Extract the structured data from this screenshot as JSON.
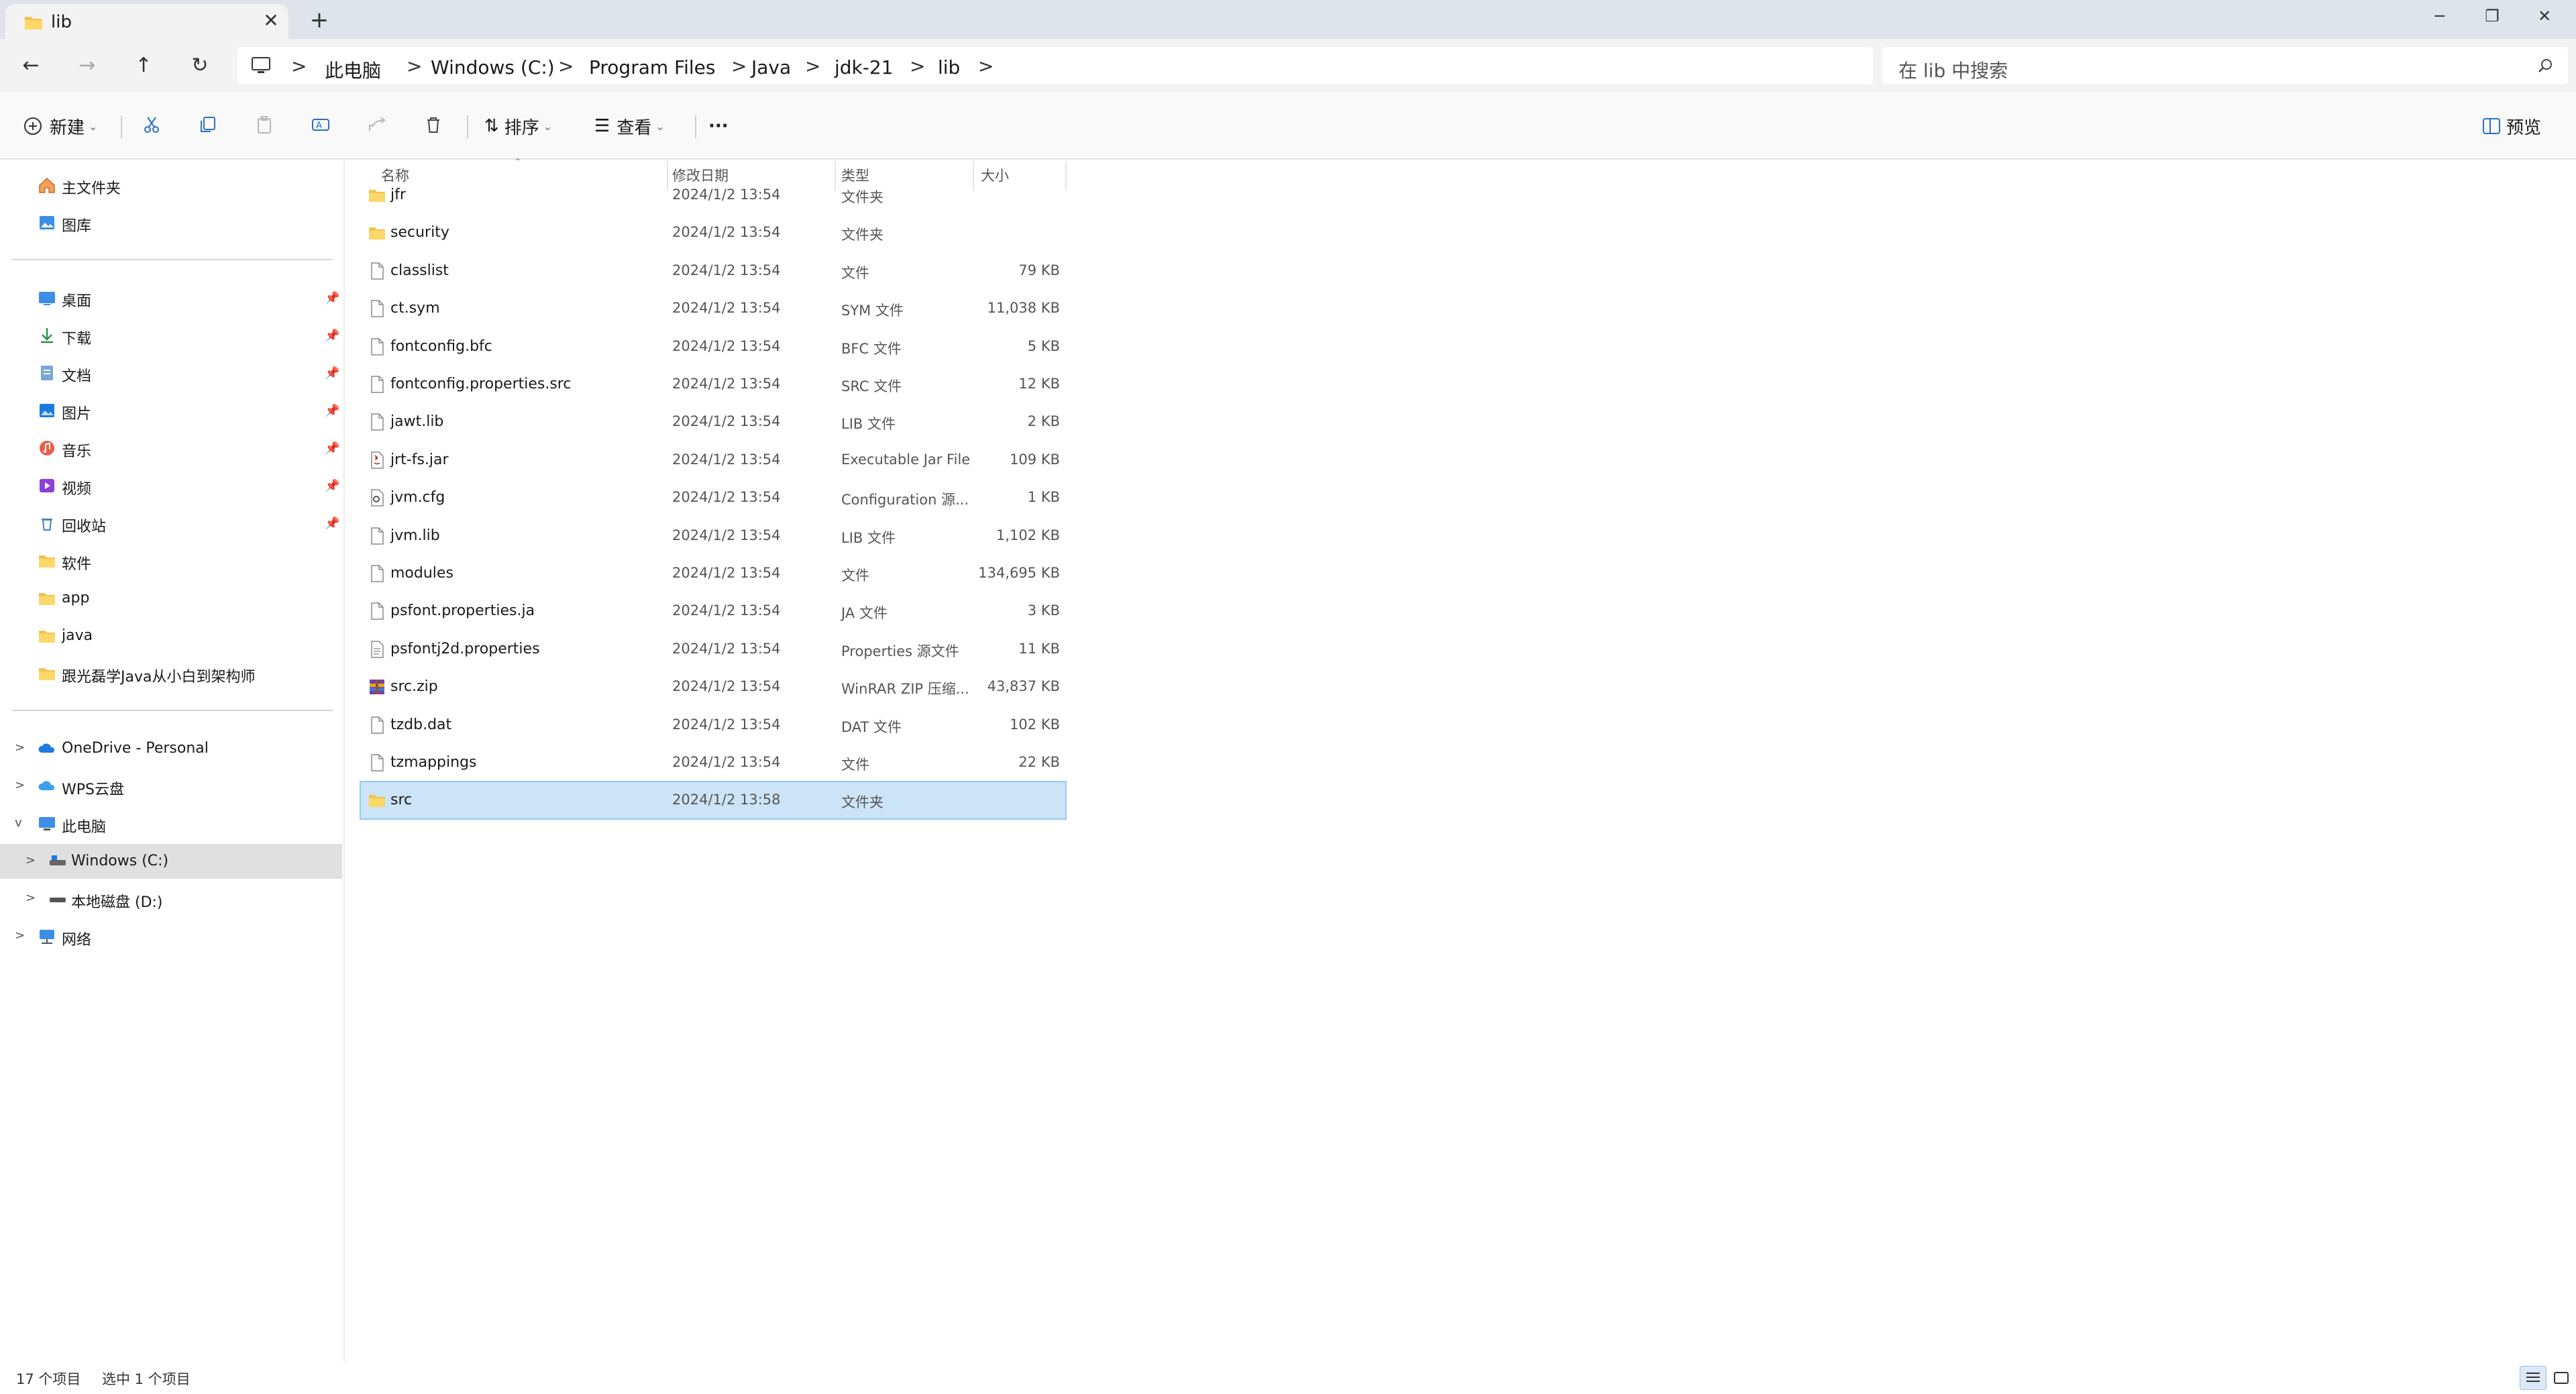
{
  "window": {
    "tab_title": "lib",
    "tab_close": "✕",
    "new_tab": "+",
    "minimize": "─",
    "restore": "❐",
    "close": "✕"
  },
  "navigation": {
    "back": "←",
    "forward": "→",
    "up": "↑",
    "refresh": "↻",
    "breadcrumb": [
      "此电脑",
      "Windows (C:)",
      "Program Files",
      "Java",
      "jdk-21",
      "lib"
    ],
    "separator": ">",
    "search_placeholder": "在 lib 中搜索"
  },
  "toolbar": {
    "new_label": "新建",
    "sort_label": "排序",
    "view_label": "查看",
    "more_label": "···",
    "preview_label": "预览",
    "icons": [
      "cut-icon",
      "copy-icon",
      "paste-icon",
      "rename-icon",
      "share-icon",
      "delete-icon"
    ]
  },
  "sidebar": {
    "quick": [
      {
        "label": "主文件夹",
        "icon": "home-icon"
      },
      {
        "label": "图库",
        "icon": "gallery-icon"
      }
    ],
    "pinned": [
      {
        "label": "桌面",
        "icon": "desktop-icon",
        "pinned": true
      },
      {
        "label": "下载",
        "icon": "download-icon",
        "pinned": true
      },
      {
        "label": "文档",
        "icon": "documents-icon",
        "pinned": true
      },
      {
        "label": "图片",
        "icon": "pictures-icon",
        "pinned": true
      },
      {
        "label": "音乐",
        "icon": "music-icon",
        "pinned": true
      },
      {
        "label": "视频",
        "icon": "videos-icon",
        "pinned": true
      },
      {
        "label": "回收站",
        "icon": "recycle-bin-icon",
        "pinned": true
      },
      {
        "label": "软件",
        "icon": "folder-icon",
        "pinned": false
      },
      {
        "label": "app",
        "icon": "folder-icon",
        "pinned": false
      },
      {
        "label": "java",
        "icon": "folder-icon",
        "pinned": false
      },
      {
        "label": "跟光磊学Java从小白到架构师",
        "icon": "folder-icon",
        "pinned": false
      }
    ],
    "tree": [
      {
        "label": "OneDrive - Personal",
        "icon": "onedrive-icon",
        "expander": ">",
        "level": 0
      },
      {
        "label": "WPS云盘",
        "icon": "wps-cloud-icon",
        "expander": ">",
        "level": 0
      },
      {
        "label": "此电脑",
        "icon": "this-pc-icon",
        "expander": "v",
        "level": 0
      },
      {
        "label": "Windows (C:)",
        "icon": "drive-c-icon",
        "expander": ">",
        "level": 1,
        "selected": true
      },
      {
        "label": "本地磁盘 (D:)",
        "icon": "drive-d-icon",
        "expander": ">",
        "level": 1
      },
      {
        "label": "网络",
        "icon": "network-icon",
        "expander": ">",
        "level": 0
      }
    ],
    "pin_glyph": "📌"
  },
  "columns": {
    "name": "名称",
    "modified": "修改日期",
    "type": "类型",
    "size": "大小"
  },
  "files": [
    {
      "name": "jfr",
      "modified": "2024/1/2 13:54",
      "type": "文件夹",
      "size": "",
      "icon": "folder-icon"
    },
    {
      "name": "security",
      "modified": "2024/1/2 13:54",
      "type": "文件夹",
      "size": "",
      "icon": "folder-icon"
    },
    {
      "name": "classlist",
      "modified": "2024/1/2 13:54",
      "type": "文件",
      "size": "79 KB",
      "icon": "file-icon"
    },
    {
      "name": "ct.sym",
      "modified": "2024/1/2 13:54",
      "type": "SYM 文件",
      "size": "11,038 KB",
      "icon": "file-icon"
    },
    {
      "name": "fontconfig.bfc",
      "modified": "2024/1/2 13:54",
      "type": "BFC 文件",
      "size": "5 KB",
      "icon": "file-icon"
    },
    {
      "name": "fontconfig.properties.src",
      "modified": "2024/1/2 13:54",
      "type": "SRC 文件",
      "size": "12 KB",
      "icon": "file-icon"
    },
    {
      "name": "jawt.lib",
      "modified": "2024/1/2 13:54",
      "type": "LIB 文件",
      "size": "2 KB",
      "icon": "file-icon"
    },
    {
      "name": "jrt-fs.jar",
      "modified": "2024/1/2 13:54",
      "type": "Executable Jar File",
      "size": "109 KB",
      "icon": "jar-icon"
    },
    {
      "name": "jvm.cfg",
      "modified": "2024/1/2 13:54",
      "type": "Configuration 源...",
      "size": "1 KB",
      "icon": "config-file-icon"
    },
    {
      "name": "jvm.lib",
      "modified": "2024/1/2 13:54",
      "type": "LIB 文件",
      "size": "1,102 KB",
      "icon": "file-icon"
    },
    {
      "name": "modules",
      "modified": "2024/1/2 13:54",
      "type": "文件",
      "size": "134,695 KB",
      "icon": "file-icon"
    },
    {
      "name": "psfont.properties.ja",
      "modified": "2024/1/2 13:54",
      "type": "JA 文件",
      "size": "3 KB",
      "icon": "file-icon"
    },
    {
      "name": "psfontj2d.properties",
      "modified": "2024/1/2 13:54",
      "type": "Properties 源文件",
      "size": "11 KB",
      "icon": "properties-file-icon"
    },
    {
      "name": "src.zip",
      "modified": "2024/1/2 13:54",
      "type": "WinRAR ZIP 压缩...",
      "size": "43,837 KB",
      "icon": "winrar-zip-icon"
    },
    {
      "name": "tzdb.dat",
      "modified": "2024/1/2 13:54",
      "type": "DAT 文件",
      "size": "102 KB",
      "icon": "file-icon"
    },
    {
      "name": "tzmappings",
      "modified": "2024/1/2 13:54",
      "type": "文件",
      "size": "22 KB",
      "icon": "file-icon"
    },
    {
      "name": "src",
      "modified": "2024/1/2 13:58",
      "type": "文件夹",
      "size": "",
      "icon": "folder-icon",
      "selected": true
    }
  ],
  "status": {
    "item_count": "17 个项目",
    "selection": "选中 1 个项目"
  },
  "colors": {
    "folder": "#f4c24f",
    "selection_bg": "#cce4f7",
    "accent": "#0067c0"
  }
}
